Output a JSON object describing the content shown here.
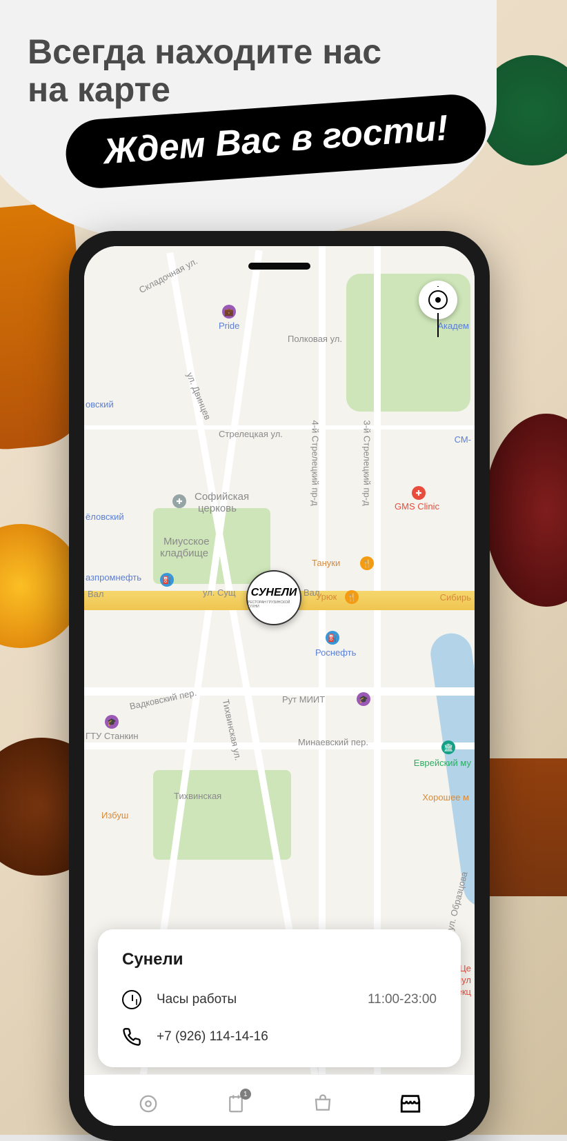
{
  "promo": {
    "headline_line1": "Всегда находите нас",
    "headline_line2": "на карте",
    "pill": "Ждем Вас в гости!"
  },
  "map": {
    "labels": {
      "pride": "Pride",
      "polkovaya": "Полковая ул.",
      "streletskaya": "Стрелецкая ул.",
      "dvintcev": "ул. Двинцев",
      "skladochnaya": "Складочная ул.",
      "strel4": "4-й Стрелецкий пр-д",
      "strel3": "3-й Стрелецкий пр-д",
      "akadem": "Академ",
      "hovskiy": "овский",
      "cmlabel": "СМ-",
      "sofiyskaya1": "Софийская",
      "sofiyskaya2": "церковь",
      "miusskoe1": "Миусское",
      "miusskoe2": "кладбище",
      "gms": "GMS Clinic",
      "elovskiy": "ёловский",
      "gazpromneft": "азпромнефть",
      "val": "Вал",
      "sushval": "ул. Сущ",
      "sushval2": "Вал",
      "tanuki": "Тануки",
      "uruk": "Урюк",
      "sibir": "Сибирь",
      "rosneft": "Роснефть",
      "rutmiit": "Рут МИИТ",
      "vadkov": "Вадковский пер.",
      "minaev": "Минаевский пер.",
      "tikhvinskaya_ul": "Тихвинская ул.",
      "stankin": "ГТУ Станкин",
      "tikhvinskaya": "Тихвинская",
      "izbu": "Избуш",
      "evrey1": "Еврейский му",
      "khoroshee": "Хорошее м",
      "obraztsova": "ул. Образцова",
      "ftizio1": "Це",
      "ftizio2": "фтизиопул",
      "ftizio3": "и инфекц"
    },
    "brand_pin": "СУНЕЛИ",
    "brand_sub": "РЕСТОРАН ГРУЗИНСКОЙ КУХНИ"
  },
  "card": {
    "name": "Сунели",
    "hours_label": "Часы работы",
    "hours_value": "11:00-23:00",
    "phone": "+7 (926) 114-14-16"
  },
  "nav": {
    "badge": "1"
  }
}
